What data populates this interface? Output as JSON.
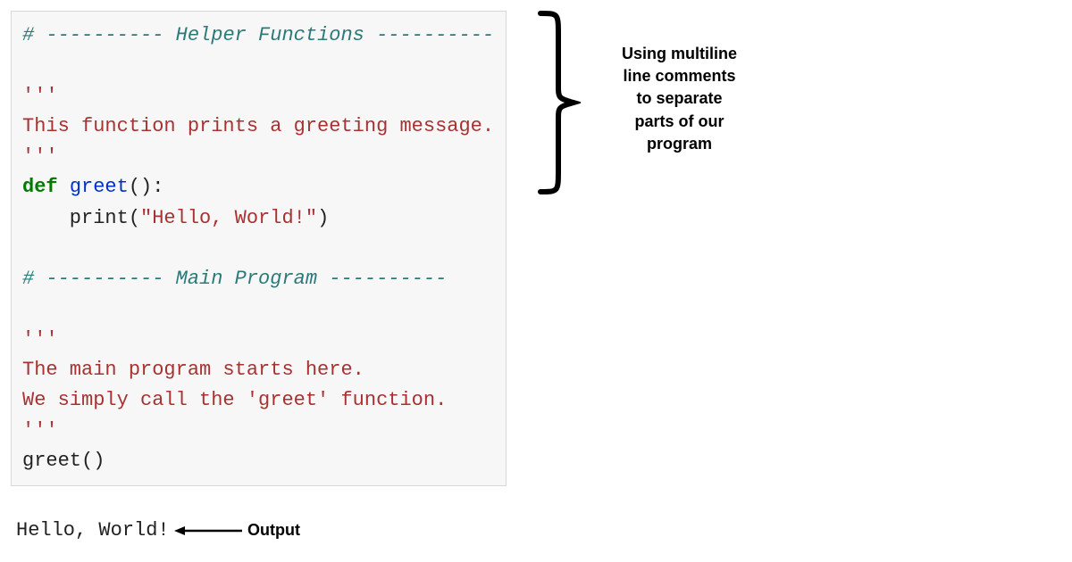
{
  "code": {
    "l1_hash": "#",
    "l1_sep": " ---------- ",
    "l1_title": "Helper Functions",
    "l1_sep2": " ----------",
    "l3_tq": "'''",
    "l4_doc": "This function prints a greeting message.",
    "l5_tq": "'''",
    "l6_def": "def ",
    "l6_name": "greet",
    "l6_paren": "():",
    "l7_indent": "    print(",
    "l7_str": "\"Hello, World!\"",
    "l7_close": ")",
    "l9_hash": "#",
    "l9_sep": " ---------- ",
    "l9_title": "Main Program",
    "l9_sep2": " ----------",
    "l11_tq": "'''",
    "l12_doc": "The main program starts here.",
    "l13_doc": "We simply call the 'greet' function.",
    "l14_tq": "'''",
    "l15_call": "greet()"
  },
  "output": "Hello, World!",
  "output_label": "Output",
  "annotation": {
    "line1": "Using multiline",
    "line2": "line comments",
    "line3": "to separate",
    "line4": "parts of our",
    "line5": "program"
  }
}
